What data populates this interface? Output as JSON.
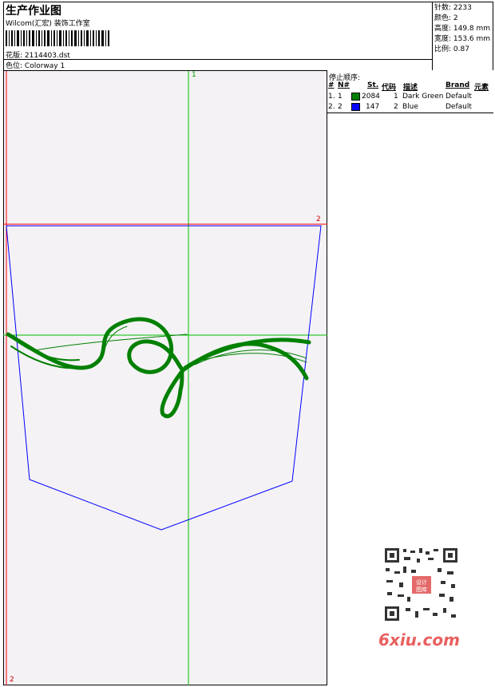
{
  "header": {
    "title": "生产作业图",
    "subtitle": "Wilcom(汇宏) 装饰工作室",
    "design_label": "花版:",
    "design_value": "2114403.dst",
    "colorway_label": "色位:",
    "colorway_value": "Colorway 1"
  },
  "stats": {
    "stitches": "针数: 2233",
    "colors": "颜色: 2",
    "height": "高度: 149.8 mm",
    "width": "宽度: 153.6 mm",
    "scale": "比例: 0.87"
  },
  "stop_sequence": {
    "title": "停止顺序:",
    "headers": [
      "#",
      "N#",
      "St.",
      "代码",
      "描述",
      "Brand",
      "元素"
    ],
    "rows": [
      {
        "index": "1.",
        "n": "1",
        "color": "#008000",
        "stitches": "2084",
        "code": "1",
        "description": "Dark Green",
        "brand": "Default"
      },
      {
        "index": "2.",
        "n": "2",
        "color": "#0000ff",
        "stitches": "147",
        "code": "2",
        "description": "Blue",
        "brand": "Default"
      }
    ]
  },
  "canvas": {
    "label_top": "1",
    "label_right": "2",
    "label_bottom": "2"
  },
  "watermark": {
    "qr_text": "设计图库",
    "site": "6xiu.com"
  },
  "colors": {
    "green": "#008000",
    "blue": "#0000ff",
    "red_guide": "#ff0000",
    "green_guide": "#00c000"
  }
}
